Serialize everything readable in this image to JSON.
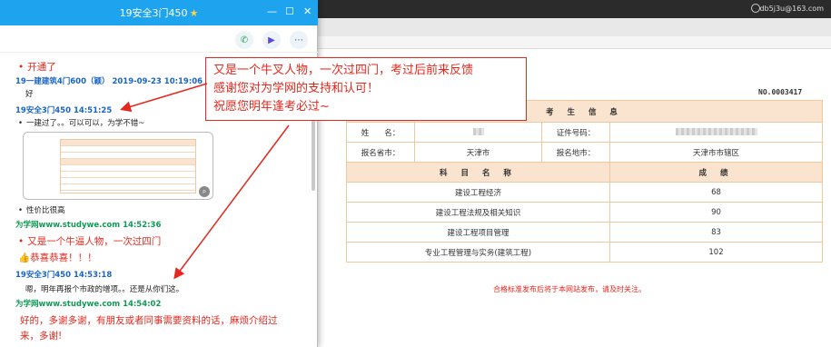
{
  "chat": {
    "title": "19安全3门450",
    "title_icon": "star-icon",
    "actions": [
      "phone-icon",
      "video-icon",
      "more-icon"
    ],
    "messages": [
      {
        "text": "开通了",
        "style": "red"
      },
      {
        "sender": "19一建建筑4门600（颖）  2019-09-23  10:19:06",
        "color": "blue"
      },
      {
        "text": "好"
      },
      {
        "sender": "19安全3门450   14:51:25",
        "color": "blue"
      },
      {
        "text": "一建过了。。可以可以，为学不错~"
      },
      {
        "text": "性价比很高"
      },
      {
        "sender": "为学网www.studywe.com   14:52:36",
        "color": "green"
      },
      {
        "text": "又是一个牛逼人物，一次过四门",
        "style": "red"
      },
      {
        "text": "恭喜恭喜！！！",
        "style": "red"
      },
      {
        "sender": "19安全3门450   14:53:18",
        "color": "blue"
      },
      {
        "text": "嗯，明年再报个市政的增项。。还是从你们这。"
      },
      {
        "sender": "为学网www.studywe.com   14:54:02",
        "color": "green"
      },
      {
        "text": "好的，多谢多谢，有朋友或者同事需要资料的话，麻烦介绍过",
        "style": "red"
      },
      {
        "text": "来，多谢!",
        "style": "red"
      }
    ]
  },
  "annotation": {
    "lines": [
      "又是一个牛叉人物，一次过四门，考过后前来反馈",
      "感谢您对为学网的支持和认可！",
      "祝愿您明年逢考必过~"
    ]
  },
  "browser": {
    "user_email": "db5j3u@163.com"
  },
  "certificate": {
    "number": "NO.0003417",
    "section_title": "考 生 信 息",
    "fields": {
      "name_label": "姓　　名：",
      "id_label": "证件号码：",
      "province_label": "报名省市：",
      "province_value": "天津市",
      "area_label": "报名地市：",
      "area_value": "天津市市辖区"
    },
    "subject_header": "科 目 名 称",
    "score_header": "成 绩",
    "subjects": [
      {
        "name": "建设工程经济",
        "score": "68"
      },
      {
        "name": "建设工程法规及相关知识",
        "score": "90"
      },
      {
        "name": "建设工程项目管理",
        "score": "83"
      },
      {
        "name": "专业工程管理与实务(建筑工程)",
        "score": "102"
      }
    ],
    "footer": "合格标准发布后将于本网站发布，请及时关注。"
  },
  "colors": {
    "chat_title_bar": "#1ea4ef",
    "annotation_red": "#e5281e",
    "cert_header": "#fbe4cf"
  }
}
